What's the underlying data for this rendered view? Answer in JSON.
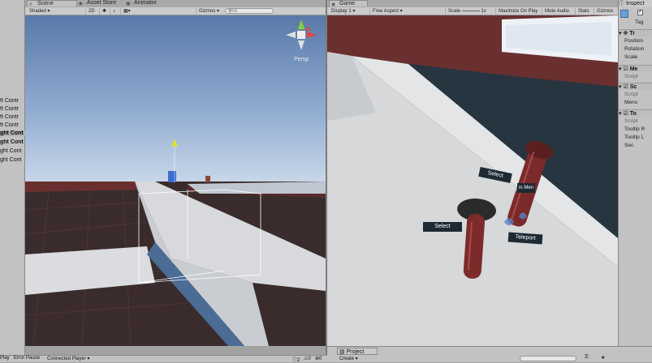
{
  "scene_tabs": {
    "scene": "Scene",
    "asset_store": "Asset Store",
    "animator": "Animator"
  },
  "scene_toolbar": {
    "shading": "Shaded",
    "mode_2d": "2D",
    "gizmos": "Gizmos",
    "search_placeholder": "All"
  },
  "scene_gizmo": {
    "persp": "Persp"
  },
  "game_tabs": {
    "game": "Game"
  },
  "game_toolbar": {
    "display": "Display 1",
    "aspect": "Free Aspect",
    "scale_label": "Scale",
    "scale_value": "1x",
    "maximize": "Maximize On Play",
    "mute": "Mute Audio",
    "stats": "Stats",
    "gizmos": "Gizmos"
  },
  "game_labels": {
    "select_top": "Select",
    "select_left": "Select",
    "teleport": "Teleport",
    "menu_partial": "in Men"
  },
  "hierarchy_items": [
    "ft Contr",
    "ft Contr",
    "ft Contr",
    "ft Contr",
    "ght Cont",
    "ght Cont",
    "ght Cont",
    "ght Cont"
  ],
  "inspector": {
    "tab": "Inspect",
    "tag_label": "Tag",
    "transform": {
      "title": "Tr",
      "position": "Position",
      "rotation": "Rotation",
      "scale": "Scale"
    },
    "comp1": {
      "title": "Me",
      "script": "Script"
    },
    "comp2": {
      "title": "Sc",
      "script": "Script",
      "menu": "Menu"
    },
    "comp3": {
      "title": "To",
      "script": "Script",
      "tooltip_r": "Tooltip R",
      "tooltip_l": "Tooltip L",
      "sec": "Sec"
    }
  },
  "project_tab": {
    "project": "Project",
    "create": "Create"
  },
  "bottom_bar": {
    "play": "Play",
    "error_pause": "Error Pause",
    "connected_player": "Connected Player",
    "console_count": "2",
    "warn_count": "0",
    "error_count": "0"
  },
  "colors": {
    "sky_top": "#5a79a8",
    "sky_bottom": "#b4c6de",
    "dark_ground": "#3b2a2a",
    "maroon_wall": "#6a3030",
    "platform": "#d7d9db",
    "game_floor": "#263540"
  }
}
